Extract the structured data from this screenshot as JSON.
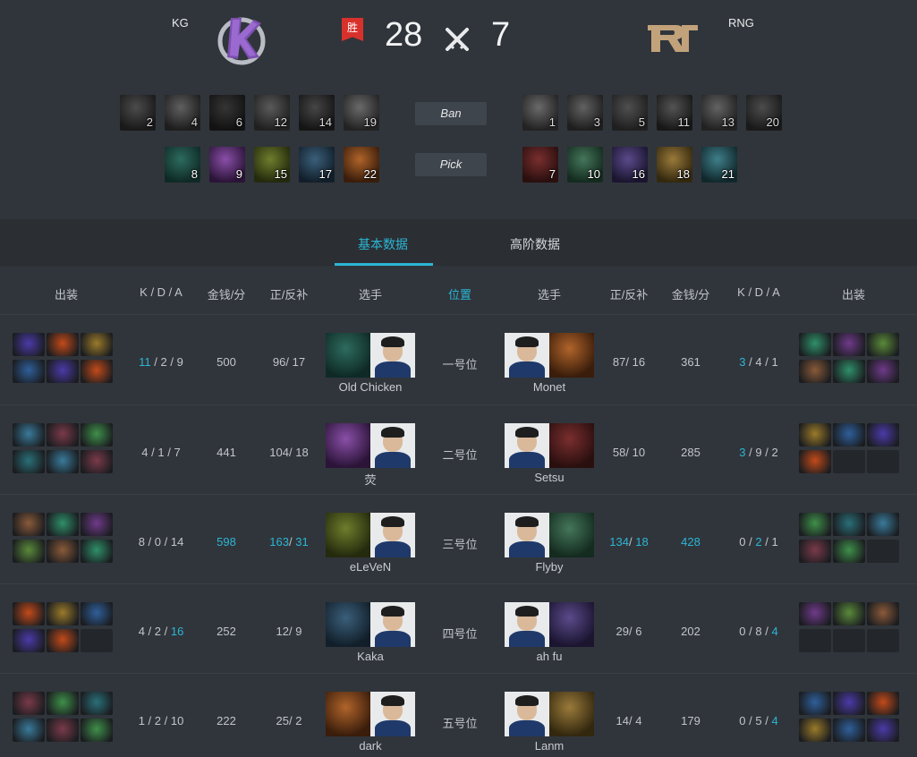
{
  "match": {
    "left_team": "KG",
    "right_team": "RNG",
    "win_label": "胜",
    "left_score": "28",
    "right_score": "7",
    "ban_label": "Ban",
    "pick_label": "Pick"
  },
  "left_bans": [
    "2",
    "4",
    "6",
    "12",
    "14",
    "19"
  ],
  "left_picks": [
    "8",
    "9",
    "15",
    "17",
    "22"
  ],
  "right_bans": [
    "1",
    "3",
    "5",
    "11",
    "13",
    "20"
  ],
  "right_picks": [
    "7",
    "10",
    "16",
    "18",
    "21"
  ],
  "tabs": {
    "basic": "基本数据",
    "advanced": "高阶数据"
  },
  "headers": {
    "items_left": "出装",
    "kda_left": "K / D / A",
    "gpm_left": "金钱/分",
    "cs_left": "正/反补",
    "player_left": "选手",
    "position": "位置",
    "player_right": "选手",
    "cs_right": "正/反补",
    "gpm_right": "金钱/分",
    "kda_right": "K / D / A",
    "items_right": "出装"
  },
  "rows": [
    {
      "position": "一号位",
      "left": {
        "k": "11",
        "d": "2",
        "a": "9",
        "gpm": "500",
        "lh": "96",
        "dn": "17",
        "player": "Old Chicken"
      },
      "right": {
        "k": "3",
        "d": "4",
        "a": "1",
        "gpm": "361",
        "lh": "87",
        "dn": "16",
        "player": "Monet"
      }
    },
    {
      "position": "二号位",
      "left": {
        "k": "4",
        "d": "1",
        "a": "7",
        "gpm": "441",
        "lh": "104",
        "dn": "18",
        "player": "荧"
      },
      "right": {
        "k": "3",
        "d": "9",
        "a": "2",
        "gpm": "285",
        "lh": "58",
        "dn": "10",
        "player": "Setsu"
      }
    },
    {
      "position": "三号位",
      "left": {
        "k": "8",
        "d": "0",
        "a": "14",
        "gpm": "598",
        "lh": "163",
        "dn": "31",
        "player": "eLeVeN"
      },
      "right": {
        "k": "0",
        "d": "2",
        "a": "1",
        "gpm": "428",
        "lh": "134",
        "dn": "18",
        "player": "Flyby"
      }
    },
    {
      "position": "四号位",
      "left": {
        "k": "4",
        "d": "2",
        "a": "16",
        "gpm": "252",
        "lh": "12",
        "dn": "9",
        "player": "Kaka"
      },
      "right": {
        "k": "0",
        "d": "8",
        "a": "4",
        "gpm": "202",
        "lh": "29",
        "dn": "6",
        "player": "ah fu"
      }
    },
    {
      "position": "五号位",
      "left": {
        "k": "1",
        "d": "2",
        "a": "10",
        "gpm": "222",
        "lh": "25",
        "dn": "2",
        "player": "dark"
      },
      "right": {
        "k": "0",
        "d": "5",
        "a": "4",
        "gpm": "179",
        "lh": "14",
        "dn": "4",
        "player": "Lanm"
      }
    }
  ],
  "colors": {
    "accent": "#2bb6d5",
    "win": "#d8312c",
    "bg": "#30353b"
  }
}
